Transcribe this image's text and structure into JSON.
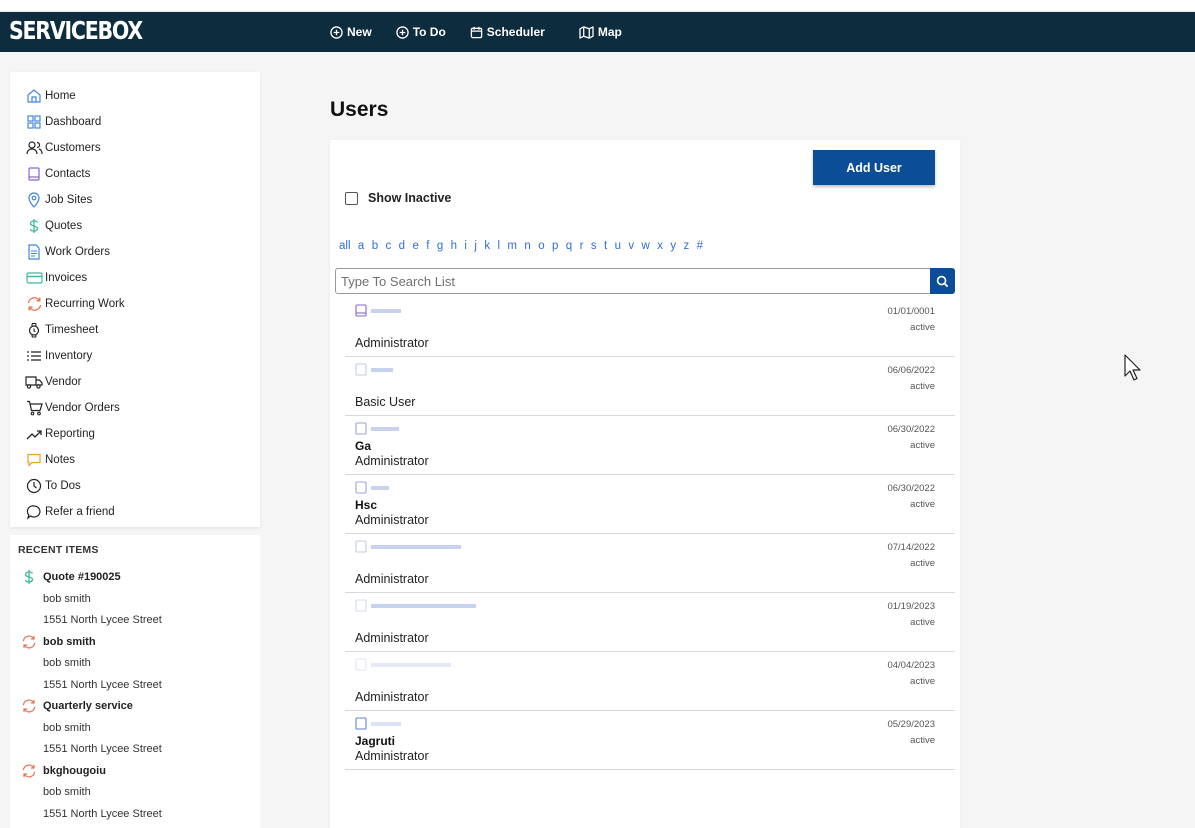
{
  "app": {
    "logo": "SERVICEBOX"
  },
  "nav": [
    {
      "label": "New",
      "icon": "plus-circle-icon"
    },
    {
      "label": "To Do",
      "icon": "plus-circle-icon"
    },
    {
      "label": "Scheduler",
      "icon": "calendar-icon"
    },
    {
      "label": "Map",
      "icon": "map-icon"
    }
  ],
  "sidebar": {
    "items": [
      {
        "label": "Home",
        "icon": "home-icon"
      },
      {
        "label": "Dashboard",
        "icon": "dashboard-icon"
      },
      {
        "label": "Customers",
        "icon": "users-icon"
      },
      {
        "label": "Contacts",
        "icon": "book-icon"
      },
      {
        "label": "Job Sites",
        "icon": "location-pin-icon"
      },
      {
        "label": "Quotes",
        "icon": "dollar-icon"
      },
      {
        "label": "Work Orders",
        "icon": "document-icon"
      },
      {
        "label": "Invoices",
        "icon": "credit-card-icon"
      },
      {
        "label": "Recurring Work",
        "icon": "refresh-icon"
      },
      {
        "label": "Timesheet",
        "icon": "watch-icon"
      },
      {
        "label": "Inventory",
        "icon": "list-icon"
      },
      {
        "label": "Vendor",
        "icon": "truck-icon"
      },
      {
        "label": "Vendor Orders",
        "icon": "cart-icon"
      },
      {
        "label": "Reporting",
        "icon": "trending-up-icon"
      },
      {
        "label": "Notes",
        "icon": "note-icon"
      },
      {
        "label": "To Dos",
        "icon": "clock-icon"
      },
      {
        "label": "Refer a friend",
        "icon": "chat-bubble-icon"
      }
    ]
  },
  "recent": {
    "title": "RECENT ITEMS",
    "items": [
      {
        "title": "Quote #190025",
        "icon": "dollar-icon",
        "customer": "bob smith",
        "address": "1551 North Lycee Street"
      },
      {
        "title": "bob smith",
        "icon": "refresh-icon",
        "customer": "bob smith",
        "address": "1551 North Lycee Street"
      },
      {
        "title": "Quarterly service",
        "icon": "refresh-icon",
        "customer": "bob smith",
        "address": "1551 North Lycee Street"
      },
      {
        "title": "bkghougoiu",
        "icon": "refresh-icon",
        "customer": "bob smith",
        "address": "1551 North Lycee Street"
      }
    ]
  },
  "page": {
    "title": "Users",
    "add_button": "Add User",
    "show_inactive": "Show Inactive",
    "letters": [
      "all",
      "a",
      "b",
      "c",
      "d",
      "e",
      "f",
      "g",
      "h",
      "i",
      "j",
      "k",
      "l",
      "m",
      "n",
      "o",
      "p",
      "q",
      "r",
      "s",
      "t",
      "u",
      "v",
      "w",
      "x",
      "y",
      "z",
      "#"
    ],
    "search_placeholder": "Type To Search List"
  },
  "users": [
    {
      "name": "",
      "role": "Administrator",
      "date": "01/01/0001",
      "status": "active"
    },
    {
      "name": "",
      "role": "Basic User",
      "date": "06/06/2022",
      "status": "active"
    },
    {
      "name": "Ga",
      "role": "Administrator",
      "date": "06/30/2022",
      "status": "active"
    },
    {
      "name": "Hsc",
      "role": "Administrator",
      "date": "06/30/2022",
      "status": "active"
    },
    {
      "name": "",
      "role": "Administrator",
      "date": "07/14/2022",
      "status": "active"
    },
    {
      "name": "",
      "role": "Administrator",
      "date": "01/19/2023",
      "status": "active"
    },
    {
      "name": "",
      "role": "Administrator",
      "date": "04/04/2023",
      "status": "active"
    },
    {
      "name": "Jagruti",
      "role": "Administrator",
      "date": "05/29/2023",
      "status": "active"
    }
  ],
  "colors": {
    "navbar": "#0d2d3e",
    "primary_button": "#0b4d96",
    "link": "#2f6fd6",
    "recurring_icon": "#e8704a",
    "quote_icon": "#3cb9a0"
  }
}
